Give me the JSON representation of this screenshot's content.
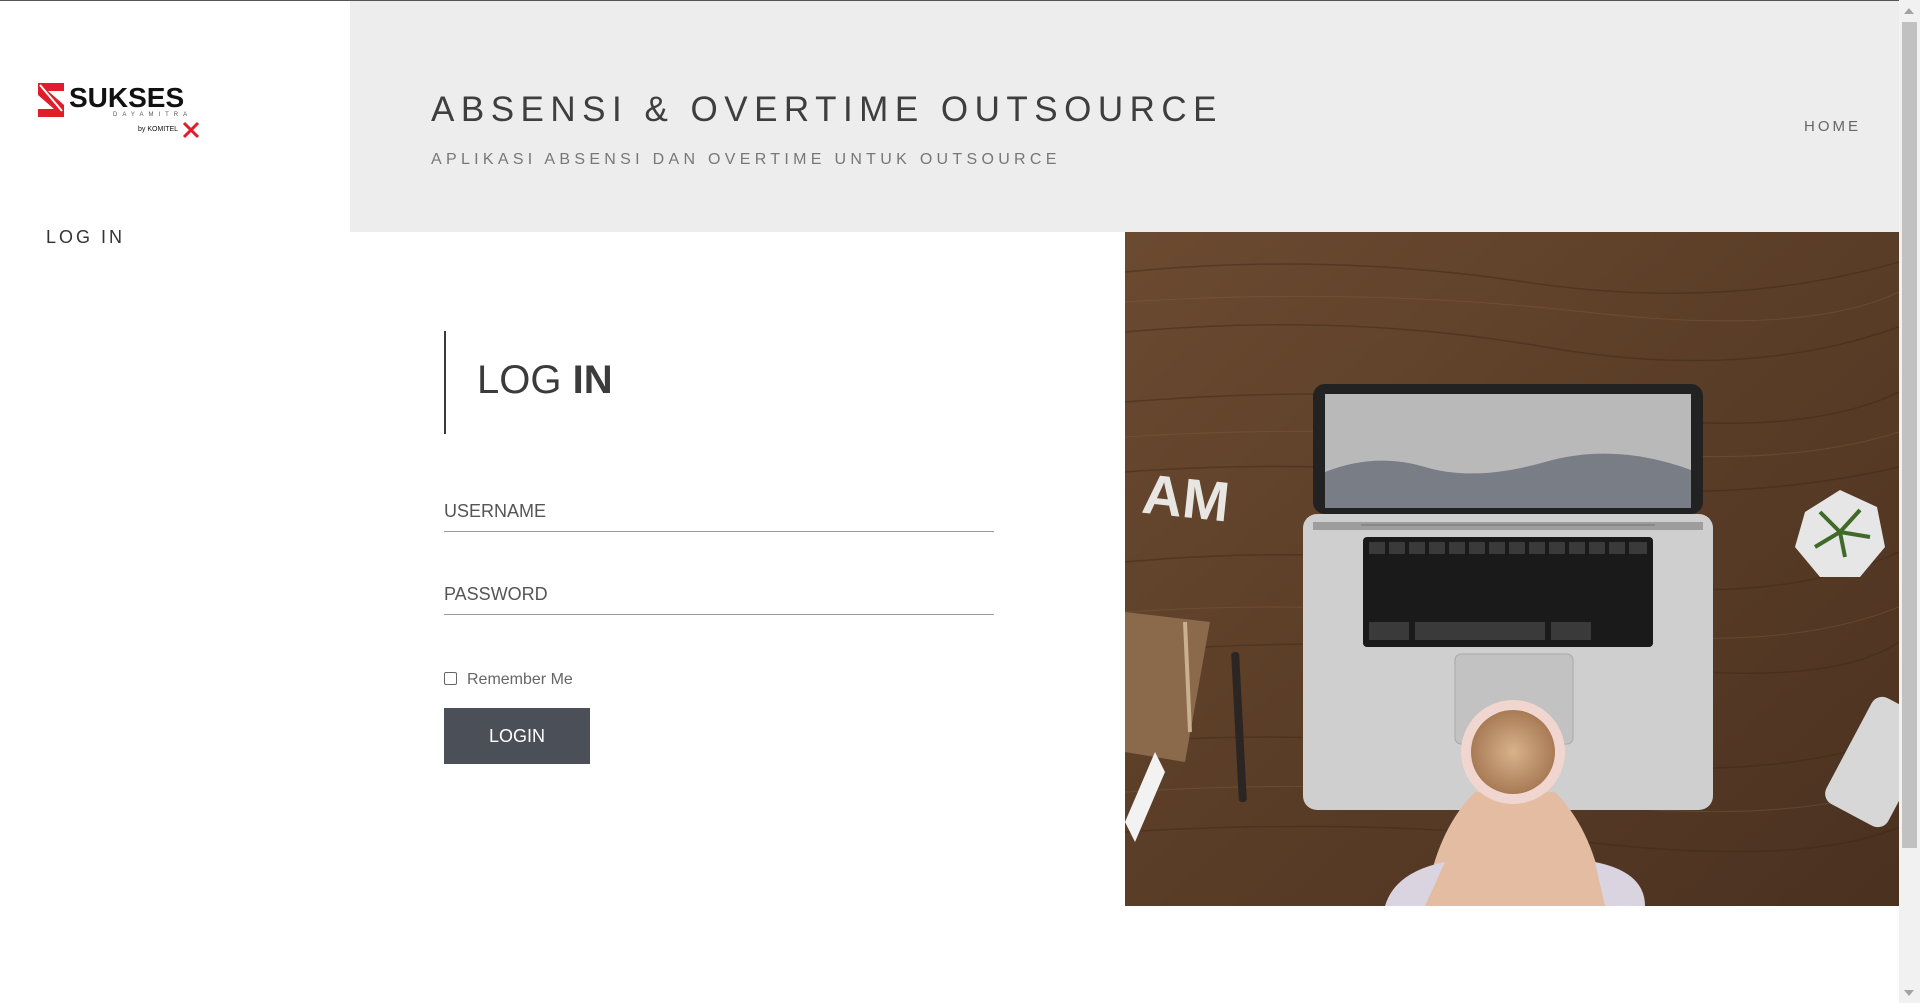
{
  "brand": {
    "logo_name": "SUKSES",
    "logo_tagline": "DAYAMITRA",
    "logo_by": "by KOMITEL",
    "logo_colors": {
      "red": "#e11d2b",
      "black": "#111111"
    }
  },
  "sidebar": {
    "nav": [
      {
        "label": "LOG IN"
      }
    ]
  },
  "header": {
    "title": "ABSENSI & OVERTIME OUTSOURCE",
    "subtitle": "APLIKASI ABSENSI DAN OVERTIME UNTUK OUTSOURCE",
    "nav": [
      {
        "label": "HOME"
      }
    ]
  },
  "login": {
    "heading_light": "LOG ",
    "heading_bold": "IN",
    "username_placeholder": "USERNAME",
    "password_placeholder": "PASSWORD",
    "remember_label": "Remember Me",
    "remember_checked": false,
    "submit_label": "LOGIN"
  },
  "colors": {
    "header_bg": "#ededed",
    "button_bg": "#4b5058",
    "text_dark": "#3e3e3e",
    "text_muted": "#777777"
  },
  "photo": {
    "subject": "desk-laptop-coffee-photo"
  }
}
